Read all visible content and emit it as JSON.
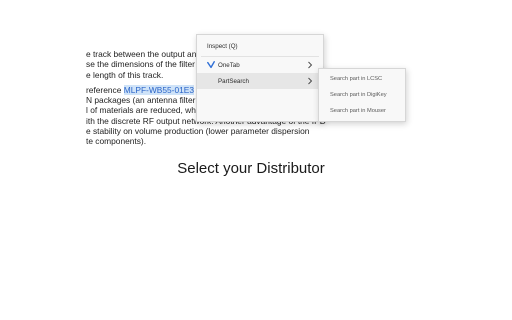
{
  "document": {
    "lines": [
      "e track between the output and the antenna can be",
      "se the dimensions of the filter and the distance by",
      "e length of this track.",
      "reference MLPF-WB55-01E3 can replace the RF output n",
      "N packages (an antenna filter is still needed) for a 2-laye",
      "l of materials are reduced, while guaranteeing equivalent",
      "ith the discrete RF output network. Another advantage of the IPD",
      "e stability on volume production (lower parameter dispersion",
      "te components)."
    ],
    "highlight_text": "MLPF-WB55-01E3"
  },
  "caption": "Select your Distributor",
  "context_menu": {
    "items": [
      {
        "label": "Inspect (Q)"
      },
      {
        "label": "OneTab",
        "icon": "onetab-icon"
      },
      {
        "label": "PartSearch"
      }
    ]
  },
  "submenu": {
    "items": [
      {
        "label": "Search part in LCSC"
      },
      {
        "label": "Search part in DigiKey"
      },
      {
        "label": "Search part in Mouser"
      }
    ]
  },
  "colors": {
    "highlight_bg": "#cfe3f8",
    "highlight_text": "#2a64c8",
    "onetab_icon": "#2f6fd6",
    "menu_active": "#e6e6e6"
  }
}
